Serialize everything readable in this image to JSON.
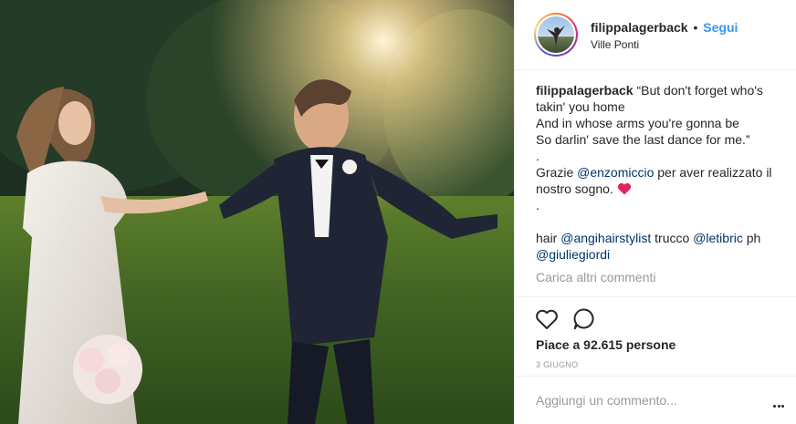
{
  "post": {
    "image_alt": "wedding photo",
    "header": {
      "username": "filippalagerback",
      "separator": "•",
      "follow_label": "Segui",
      "location": "Ville Ponti"
    },
    "caption": {
      "username": "filippalagerback",
      "line1": "“But don't forget who's takin' you home",
      "line2": "And in whose arms you're gonna be",
      "line3": "So darlin' save the last dance for me.”",
      "dot1": ".",
      "thanks_prefix": "Grazie ",
      "thanks_mention": "@enzomiccio",
      "thanks_suffix": " per aver realizzato il nostro sogno. ",
      "dot2": ".",
      "credits_hair": "hair ",
      "credits_hair_mention": "@angihairstylist",
      "credits_makeup": " trucco ",
      "credits_makeup_mention": "@letibric",
      "credits_ph": " ph ",
      "credits_ph_mention": "@giuliegiordi"
    },
    "load_more_comments": "Carica altri commenti",
    "actions": {
      "like_icon": "heart-outline-icon",
      "comment_icon": "speech-bubble-icon"
    },
    "likes_text": "Piace a 92.615 persone",
    "date": "3 GIUGNO",
    "comment_box": {
      "placeholder": "Aggiungi un commento..."
    },
    "colors": {
      "link": "#3897f0",
      "mention": "#003569",
      "muted": "#999999",
      "border": "#efefef",
      "heart_emoji": "#e0245e"
    }
  }
}
